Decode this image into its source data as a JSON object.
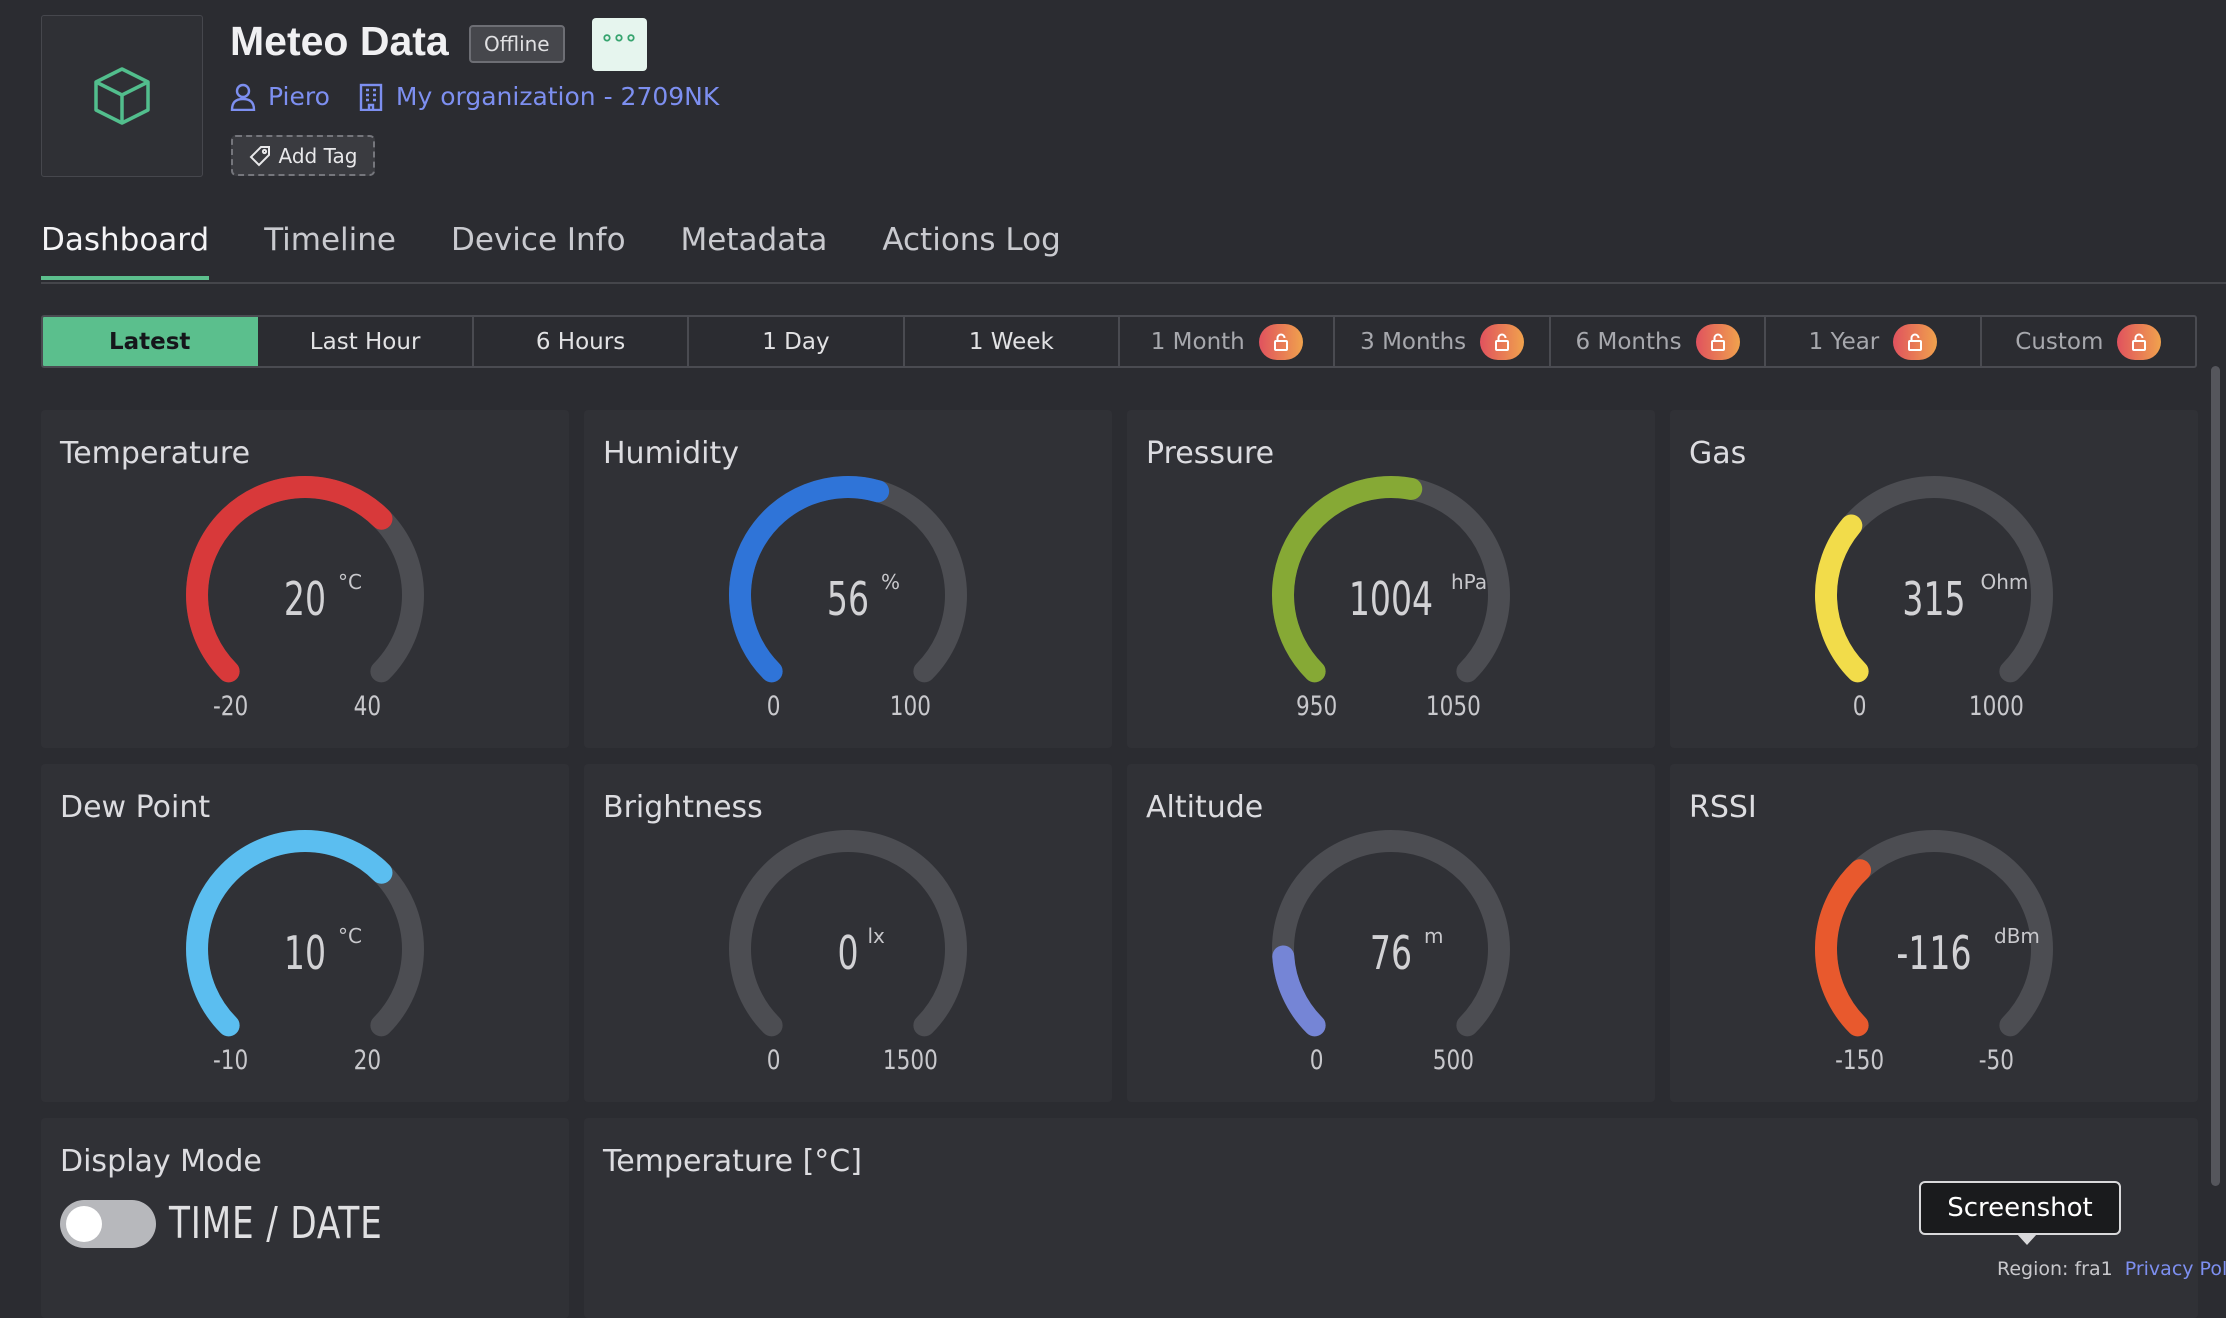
{
  "header": {
    "title": "Meteo Data",
    "status": "Offline",
    "owner": "Piero",
    "organization": "My organization - 2709NK",
    "add_tag_label": "Add Tag",
    "menu_icon": "ellipsis-icon",
    "device_icon": "cube-icon"
  },
  "tabs": [
    {
      "label": "Dashboard",
      "active": true
    },
    {
      "label": "Timeline"
    },
    {
      "label": "Device Info"
    },
    {
      "label": "Metadata"
    },
    {
      "label": "Actions Log"
    }
  ],
  "time_ranges": [
    {
      "label": "Latest",
      "active": true
    },
    {
      "label": "Last Hour"
    },
    {
      "label": "6 Hours"
    },
    {
      "label": "1 Day"
    },
    {
      "label": "1 Week"
    },
    {
      "label": "1 Month",
      "locked": true
    },
    {
      "label": "3 Months",
      "locked": true
    },
    {
      "label": "6 Months",
      "locked": true
    },
    {
      "label": "1 Year",
      "locked": true
    },
    {
      "label": "Custom",
      "locked": true
    }
  ],
  "gauges": [
    {
      "title": "Temperature",
      "value": "20",
      "unit": "°C",
      "min": "-20",
      "max": "40",
      "fraction": 0.667,
      "color": "#d8393a"
    },
    {
      "title": "Humidity",
      "value": "56",
      "unit": "%",
      "min": "0",
      "max": "100",
      "fraction": 0.56,
      "color": "#2f74d8"
    },
    {
      "title": "Pressure",
      "value": "1004",
      "unit": "hPa",
      "min": "950",
      "max": "1050",
      "fraction": 0.54,
      "color": "#86a935"
    },
    {
      "title": "Gas",
      "value": "315",
      "unit": "Ohm",
      "min": "0",
      "max": "1000",
      "fraction": 0.315,
      "color": "#f2dc4a"
    },
    {
      "title": "Dew Point",
      "value": "10",
      "unit": "°C",
      "min": "-10",
      "max": "20",
      "fraction": 0.667,
      "color": "#5bbef0"
    },
    {
      "title": "Brightness",
      "value": "0",
      "unit": "lx",
      "min": "0",
      "max": "1500",
      "fraction": 0,
      "color": "#9aa0a8"
    },
    {
      "title": "Altitude",
      "value": "76",
      "unit": "m",
      "min": "0",
      "max": "500",
      "fraction": 0.152,
      "color": "#7585d6"
    },
    {
      "title": "RSSI",
      "value": "-116",
      "unit": "dBm",
      "min": "-150",
      "max": "-50",
      "fraction": 0.34,
      "color": "#e8592d"
    }
  ],
  "display_mode": {
    "title": "Display Mode",
    "value": "TIME / DATE",
    "toggle_on": false
  },
  "chart_widget": {
    "title": "Temperature [°C]"
  },
  "tooltip": "Screenshot",
  "footer": {
    "region": "Region: fra1",
    "privacy": "Privacy Pol"
  }
}
